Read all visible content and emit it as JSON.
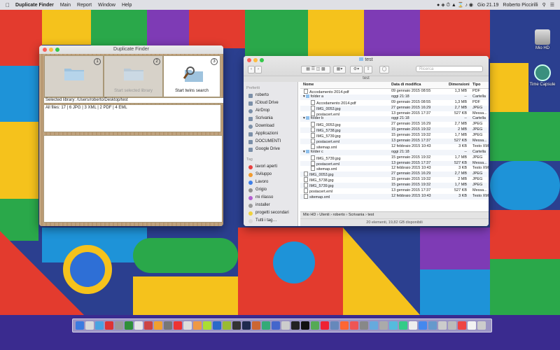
{
  "menubar": {
    "app_name": "Duplicate Finder",
    "menus": [
      "Main",
      "Report",
      "Window",
      "Help"
    ],
    "clock": "Gio 21.19",
    "user": "Roberto Piccirilli"
  },
  "desktop": {
    "icons": [
      {
        "label": "Mio HD",
        "icon": "hard-drive-icon"
      },
      {
        "label": "Time Capsule",
        "icon": "time-capsule-icon"
      }
    ]
  },
  "duplicate_finder": {
    "title": "Duplicate Finder",
    "steps": [
      {
        "num": "1",
        "label": "",
        "icon": "folder-icon"
      },
      {
        "num": "2",
        "label": "Start selected library",
        "icon": "folder-icon"
      },
      {
        "num": "3",
        "label": "Start twins search",
        "icon": "magnifier-folder-icon"
      }
    ],
    "selected_library": "Selected library: /Users/roberto/Desktop/test",
    "summary": "All files: 17 | 6 JPG | 3 XML | 2 PDF | 4 EML"
  },
  "finder": {
    "title": "test",
    "path_tab": "test",
    "search_placeholder": "Ricerca",
    "sidebar": {
      "favorites_header": "Preferiti",
      "favorites": [
        {
          "label": "roberto",
          "icon": "home-icon"
        },
        {
          "label": "iCloud Drive",
          "icon": "cloud-icon"
        },
        {
          "label": "AirDrop",
          "icon": "airdrop-icon"
        },
        {
          "label": "Scrivania",
          "icon": "desktop-icon"
        },
        {
          "label": "Download",
          "icon": "download-icon"
        },
        {
          "label": "Applicazioni",
          "icon": "applications-icon"
        },
        {
          "label": "DOCUMENTI",
          "icon": "folder-icon"
        },
        {
          "label": "Google Drive",
          "icon": "folder-icon"
        }
      ],
      "tags_header": "Tag",
      "tags": [
        {
          "label": "lavori aperti",
          "color": "#e84040"
        },
        {
          "label": "Sviluppo",
          "color": "#f29a2e"
        },
        {
          "label": "Lavoro",
          "color": "#3d7ee8"
        },
        {
          "label": "Grigio",
          "color": "#8e8e8e"
        },
        {
          "label": "mi rilasso",
          "color": "#b45fd1"
        },
        {
          "label": "installer",
          "color": "#9a9a9a"
        },
        {
          "label": "progetti secondari",
          "color": "#f0d23c"
        },
        {
          "label": "Tutti i tag…",
          "color": "#d8d8d8"
        }
      ]
    },
    "columns": [
      "Nome",
      "Data di modifica",
      "Dimensioni",
      "Tipo"
    ],
    "rows": [
      {
        "name": "Accodamento 2014.pdf",
        "date": "09 gennaio 2015 08:55",
        "size": "1,3 MB",
        "type": "PDF",
        "level": 0,
        "kind": "doc",
        "disclosure": ""
      },
      {
        "name": "folder a",
        "date": "oggi 21:18",
        "size": "--",
        "type": "Cartella",
        "level": 0,
        "kind": "folder",
        "disclosure": "▾"
      },
      {
        "name": "Accodamento 2014.pdf",
        "date": "09 gennaio 2015 08:55",
        "size": "1,3 MB",
        "type": "PDF",
        "level": 1,
        "kind": "doc",
        "disclosure": ""
      },
      {
        "name": "IMG_0053.jpg",
        "date": "27 gennaio 2015 16:29",
        "size": "2,7 MB",
        "type": "JPEG",
        "level": 1,
        "kind": "doc",
        "disclosure": ""
      },
      {
        "name": "postacert.eml",
        "date": "13 gennaio 2015 17:37",
        "size": "527 KB",
        "type": "Messa...",
        "level": 1,
        "kind": "doc",
        "disclosure": ""
      },
      {
        "name": "folder b",
        "date": "oggi 21:18",
        "size": "--",
        "type": "Cartella",
        "level": 0,
        "kind": "folder",
        "disclosure": "▾"
      },
      {
        "name": "IMG_0053.jpg",
        "date": "27 gennaio 2015 16:29",
        "size": "2,7 MB",
        "type": "JPEG",
        "level": 1,
        "kind": "doc",
        "disclosure": ""
      },
      {
        "name": "IMG_5738.jpg",
        "date": "15 gennaio 2015 19:32",
        "size": "2 MB",
        "type": "JPEG",
        "level": 1,
        "kind": "doc",
        "disclosure": ""
      },
      {
        "name": "IMG_5739.jpg",
        "date": "15 gennaio 2015 19:32",
        "size": "1,7 MB",
        "type": "JPEG",
        "level": 1,
        "kind": "doc",
        "disclosure": ""
      },
      {
        "name": "postacert.eml",
        "date": "13 gennaio 2015 17:37",
        "size": "527 KB",
        "type": "Messa...",
        "level": 1,
        "kind": "doc",
        "disclosure": ""
      },
      {
        "name": "sitemap.xml",
        "date": "12 febbraio 2015 10:43",
        "size": "3 KB",
        "type": "Testo XML",
        "level": 1,
        "kind": "doc",
        "disclosure": ""
      },
      {
        "name": "folder c",
        "date": "oggi 21:18",
        "size": "--",
        "type": "Cartella",
        "level": 0,
        "kind": "folder",
        "disclosure": "▾"
      },
      {
        "name": "IMG_5739.jpg",
        "date": "15 gennaio 2015 19:32",
        "size": "1,7 MB",
        "type": "JPEG",
        "level": 1,
        "kind": "doc",
        "disclosure": ""
      },
      {
        "name": "postacert.eml",
        "date": "13 gennaio 2015 17:37",
        "size": "527 KB",
        "type": "Messa...",
        "level": 1,
        "kind": "doc",
        "disclosure": ""
      },
      {
        "name": "sitemap.xml",
        "date": "12 febbraio 2015 10:43",
        "size": "3 KB",
        "type": "Testo XML",
        "level": 1,
        "kind": "doc",
        "disclosure": ""
      },
      {
        "name": "IMG_0053.jpg",
        "date": "27 gennaio 2015 16:29",
        "size": "2,7 MB",
        "type": "JPEG",
        "level": 0,
        "kind": "doc",
        "disclosure": ""
      },
      {
        "name": "IMG_5738.jpg",
        "date": "15 gennaio 2015 19:32",
        "size": "2 MB",
        "type": "JPEG",
        "level": 0,
        "kind": "doc",
        "disclosure": ""
      },
      {
        "name": "IMG_5739.jpg",
        "date": "15 gennaio 2015 19:32",
        "size": "1,7 MB",
        "type": "JPEG",
        "level": 0,
        "kind": "doc",
        "disclosure": ""
      },
      {
        "name": "postacert.eml",
        "date": "13 gennaio 2015 17:37",
        "size": "527 KB",
        "type": "Messa...",
        "level": 0,
        "kind": "doc",
        "disclosure": ""
      },
      {
        "name": "sitemap.xml",
        "date": "12 febbraio 2015 10:43",
        "size": "3 KB",
        "type": "Testo XML",
        "level": 0,
        "kind": "doc",
        "disclosure": ""
      }
    ],
    "breadcrumb": [
      "Mio HD",
      "Utenti",
      "roberto",
      "Scrivania",
      "test"
    ],
    "status": "20 elementi, 19,82 GB disponibili"
  },
  "dock": {
    "colors": [
      "#3b7be0",
      "#d9d9d9",
      "#4aa3e0",
      "#d33",
      "#999",
      "#2f8f3a",
      "#e6e6e6",
      "#c44",
      "#f0a030",
      "#777",
      "#e33",
      "#ddd",
      "#e94",
      "#ad3",
      "#2a6ac8",
      "#9b3",
      "#333",
      "#1f2a4f",
      "#cc6633",
      "#3a7",
      "#46c",
      "#ccc",
      "#222",
      "#111",
      "#5a5",
      "#e23",
      "#68b",
      "#f63",
      "#e55",
      "#888",
      "#6ad",
      "#aaa",
      "#5bd",
      "#3c8",
      "#eee",
      "#48e",
      "#69c",
      "#ccc",
      "#bbb",
      "#e44",
      "#f2f2f2",
      "#ccc"
    ]
  }
}
